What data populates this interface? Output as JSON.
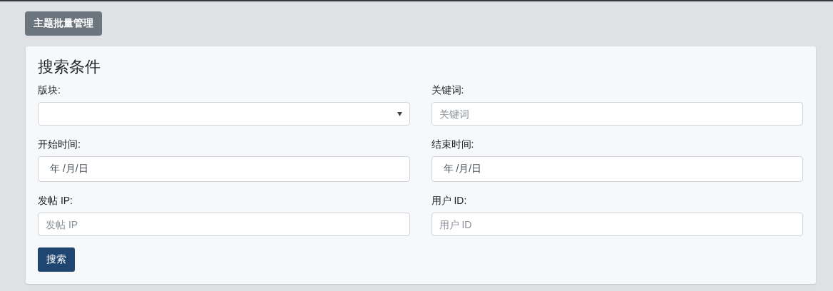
{
  "toolbar": {
    "button": "主题批量管理"
  },
  "search_panel": {
    "title": "搜索条件",
    "fields": [
      {
        "kind": "select",
        "label": "版块:"
      },
      {
        "kind": "text",
        "label": "关键词:",
        "placeholder": "关键词"
      },
      {
        "kind": "date",
        "label": "开始时间:",
        "value": "年 /月/日"
      },
      {
        "kind": "date",
        "label": "结束时间:",
        "value": "年 /月/日"
      },
      {
        "kind": "text",
        "label": "发帖 IP:",
        "placeholder": "发帖 IP"
      },
      {
        "kind": "text",
        "label": "用户 ID:",
        "placeholder": "用户 ID"
      }
    ],
    "submit": "搜索"
  }
}
